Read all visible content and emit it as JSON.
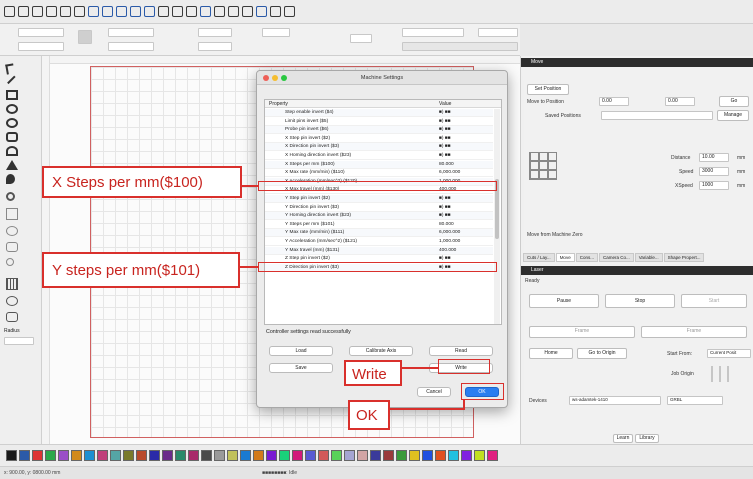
{
  "dialog": {
    "title": "Machine Settings",
    "col_property": "Property",
    "col_value": "Value",
    "rows": [
      {
        "name": "Step enable invert ($4)",
        "value": "■) ■■"
      },
      {
        "name": "Limit pins invert ($5)",
        "value": "■) ■■"
      },
      {
        "name": "Probe pin invert ($6)",
        "value": "■) ■■"
      },
      {
        "name": "X Step pin invert ($2)",
        "value": "■) ■■"
      },
      {
        "name": "X Direction pin invert ($3)",
        "value": "■) ■■"
      },
      {
        "name": "X Homing direction invert ($23)",
        "value": "■) ■■"
      },
      {
        "name": "X Steps per mm ($100)",
        "value": "80.000"
      },
      {
        "name": "X Max rate (mm/min) ($110)",
        "value": "6,000.000"
      },
      {
        "name": "X Acceleration (mm/sec^2) ($120)",
        "value": "1,000.000"
      },
      {
        "name": "X Max travel (mm) ($130)",
        "value": "400.000"
      },
      {
        "name": "Y Step pin invert ($2)",
        "value": "■) ■■"
      },
      {
        "name": "Y Direction pin invert ($3)",
        "value": "■) ■■"
      },
      {
        "name": "Y Homing direction invert ($23)",
        "value": "■) ■■"
      },
      {
        "name": "Y Steps per mm ($101)",
        "value": "80.000"
      },
      {
        "name": "Y Max rate (mm/min) ($111)",
        "value": "6,000.000"
      },
      {
        "name": "Y Acceleration (mm/sec^2) ($121)",
        "value": "1,000.000"
      },
      {
        "name": "Y Max travel (mm) ($131)",
        "value": "400.000"
      },
      {
        "name": "Z Step pin invert ($2)",
        "value": "■) ■■"
      },
      {
        "name": "Z Direction pin invert ($3)",
        "value": "■) ■■"
      }
    ],
    "status_text": "Controller settings read successfully",
    "buttons": {
      "load": "Load",
      "calibrate": "Calibrate Axis",
      "read": "Read",
      "save": "Save",
      "write": "Write",
      "cancel": "Cancel",
      "ok": "OK"
    }
  },
  "callouts": {
    "x_steps": "X Steps per mm($100)",
    "y_steps": "Y steps per mm($101)",
    "write": "Write",
    "ok": "OK"
  },
  "right_panel": {
    "move_header": "Move",
    "set_position": "Set Position",
    "move_to_position": "Move to Position",
    "x_val": "0.00",
    "y_val": "0.00",
    "go": "Go",
    "saved_positions": "Saved Positions",
    "manage": "Manage",
    "distance_label": "Distance",
    "distance_val": "10.00",
    "speed_label": "Speed",
    "speed_val": "3000",
    "xyspeed_label": "XSpeed",
    "xyspeed_val": "1000",
    "mm": "mm",
    "move_from_zero": "Move from Machine Zero",
    "tabs": [
      "Cuts / Lay...",
      "Move",
      "Cons...",
      "Camera Co...",
      "Variable...",
      "Shape Propert..."
    ],
    "laser_header": "Laser",
    "ready": "Ready",
    "pause": "Pause",
    "stop": "Stop",
    "start": "Start",
    "frame": "Frame",
    "home": "Home",
    "go_to_origin": "Go to Origin",
    "start_from": "Start From:",
    "start_from_val": "Current Posit",
    "job_origin": "Job Origin",
    "devices": "Devices",
    "device_val": "ws-adamtek-1410",
    "device_mode": "GRBL",
    "learn": "Learn",
    "library": "Library"
  },
  "left_tools": {
    "radius_label": "Radius"
  },
  "status_bar": {
    "coords": "x: 900.00, y: 0800.00 mm",
    "center": "■■■■■■■■: Idle"
  },
  "palette_colors": [
    "#1a1a1a",
    "#2b5aa8",
    "#d33",
    "#2aa84a",
    "#9a4ec7",
    "#d28a1c",
    "#1c8fd2",
    "#c0407a",
    "#55a5a5",
    "#7a7a2a",
    "#b84a2a",
    "#2a2aa8",
    "#6a2a8a",
    "#2a8a6a",
    "#a82a6a",
    "#4a4a4a",
    "#9a9a9a",
    "#c1c15a",
    "#1a7ad2",
    "#d27a1a",
    "#7a1ad2",
    "#1ad27a",
    "#d21a7a",
    "#5a5ad2",
    "#d25a5a",
    "#5ad25a",
    "#a5a5d2",
    "#d2a5a5",
    "#3a3a9a",
    "#9a3a3a",
    "#3a9a3a",
    "#e0c020",
    "#2050e0",
    "#e05020",
    "#20c0e0",
    "#8020e0",
    "#c0e020",
    "#e02080"
  ]
}
